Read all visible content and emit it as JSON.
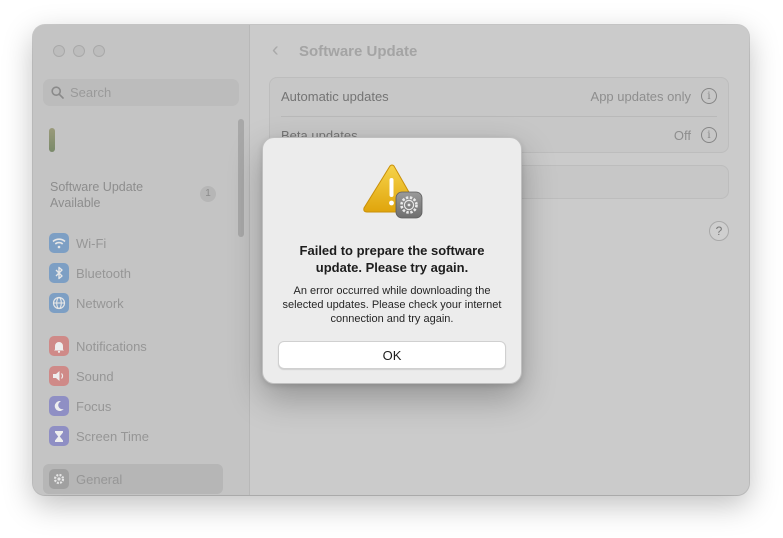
{
  "sidebar": {
    "search_placeholder": "Search",
    "update_available": "Software Update Available",
    "update_badge": "1",
    "items": [
      {
        "label": "Wi-Fi",
        "icon": "wifi-icon",
        "color": "#7d9fc4"
      },
      {
        "label": "Bluetooth",
        "icon": "bluetooth-icon",
        "color": "#7d9fc4"
      },
      {
        "label": "Network",
        "icon": "globe-icon",
        "color": "#7d9fc4"
      },
      {
        "label": "Notifications",
        "icon": "bell-icon",
        "color": "#cf8a88"
      },
      {
        "label": "Sound",
        "icon": "speaker-icon",
        "color": "#cf8a88"
      },
      {
        "label": "Focus",
        "icon": "moon-icon",
        "color": "#8f8fc4"
      },
      {
        "label": "Screen Time",
        "icon": "hourglass-icon",
        "color": "#8f8fc4"
      },
      {
        "label": "General",
        "icon": "gear-icon",
        "color": "#a0a0a0"
      }
    ]
  },
  "header": {
    "title": "Software Update"
  },
  "settings": {
    "automatic_label": "Automatic updates",
    "automatic_value": "App updates only",
    "beta_label": "Beta updates",
    "beta_value": "Off",
    "help_label": "?"
  },
  "dialog": {
    "title": "Failed to prepare the software update. Please try again.",
    "message": "An error occurred while downloading the selected updates. Please check your internet connection and try again.",
    "ok_label": "OK"
  }
}
